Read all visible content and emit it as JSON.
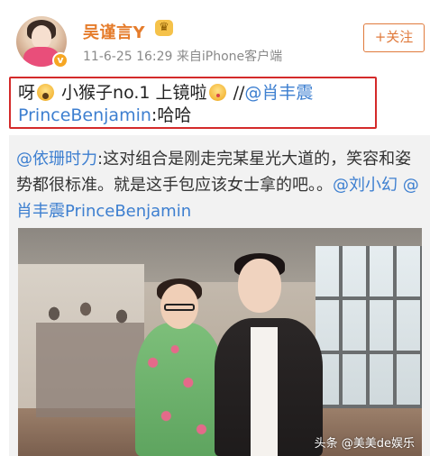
{
  "user": {
    "name": "吴谨言Y",
    "level_icon": "crown-icon",
    "verified_badge": "verified-icon",
    "meta": "11-6-25 16:29  来自iPhone客户端"
  },
  "follow_button": {
    "label": "+关注"
  },
  "post": {
    "prefix": "呀",
    "text_main": " 小猴子no.1 上镜啦",
    "slashes": " //",
    "mention": "@肖丰震PrinceBenjamin",
    "suffix": ":哈哈"
  },
  "repost": {
    "mention_author": "@依珊时力",
    "text": ":这对组合是刚走完某星光大道的，笑容和姿势都很标准。就是这手包应该女士拿的吧。。",
    "mention_1": "@刘小幻",
    "mention_2": "@肖丰震PrinceBenjamin"
  },
  "watermark": "头条 @美美de娱乐",
  "colors": {
    "username": "#e57c2b",
    "mention": "#3d7fd0",
    "highlight_border": "#d42a2a",
    "follow_border": "#e07a3c"
  }
}
